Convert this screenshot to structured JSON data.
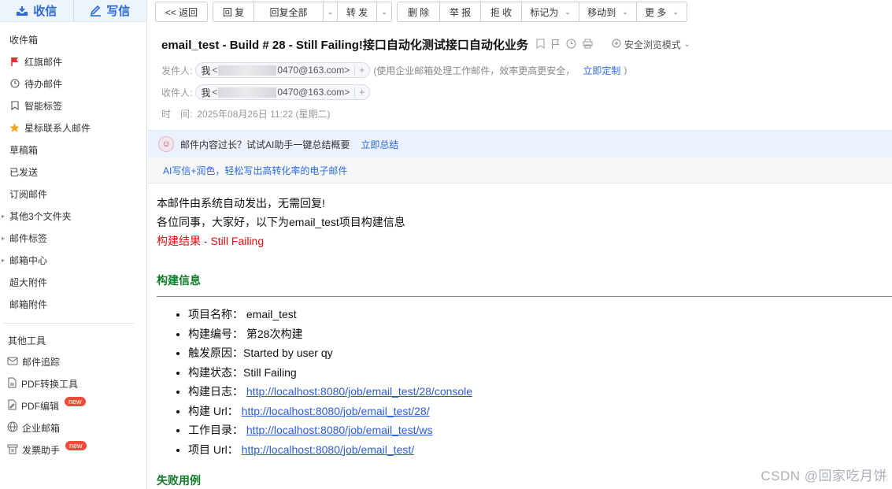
{
  "sidebar": {
    "receive_label": "收信",
    "write_label": "写信",
    "items": [
      {
        "label": "收件箱",
        "icon": ""
      },
      {
        "label": "红旗邮件",
        "icon": "flag-icon"
      },
      {
        "label": "待办邮件",
        "icon": "clock-icon"
      },
      {
        "label": "智能标签",
        "icon": "bookmark-icon"
      },
      {
        "label": "星标联系人邮件",
        "icon": "star-icon"
      },
      {
        "label": "草稿箱",
        "icon": ""
      },
      {
        "label": "已发送",
        "icon": ""
      },
      {
        "label": "订阅邮件",
        "icon": ""
      },
      {
        "label": "其他3个文件夹",
        "icon": "",
        "expandable": true
      },
      {
        "label": "邮件标签",
        "icon": "",
        "expandable": true
      },
      {
        "label": "邮箱中心",
        "icon": "",
        "expandable": true
      },
      {
        "label": "超大附件",
        "icon": ""
      },
      {
        "label": "邮箱附件",
        "icon": ""
      }
    ],
    "tools_title": "其他工具",
    "tools": [
      {
        "label": "邮件追踪",
        "icon": "envelope-track-icon",
        "badge": ""
      },
      {
        "label": "PDF转换工具",
        "icon": "pdf-convert-icon",
        "badge": ""
      },
      {
        "label": "PDF编辑",
        "icon": "pdf-edit-icon",
        "badge": "new"
      },
      {
        "label": "企业邮箱",
        "icon": "globe-icon",
        "badge": ""
      },
      {
        "label": "发票助手",
        "icon": "invoice-icon",
        "badge": "new"
      }
    ]
  },
  "toolbar": {
    "back": "<< 返回",
    "reply": "回 复",
    "reply_all": "回复全部",
    "forward": "转 发",
    "delete": "删 除",
    "report": "举 报",
    "reject": "拒 收",
    "mark_as": "标记为",
    "move_to": "移动到",
    "more": "更 多"
  },
  "mail": {
    "subject": "email_test - Build # 28 - Still Failing!接口自动化测试接口自动化业务",
    "safe_mode": "安全浏览模式",
    "from_label": "发件人:",
    "from_me": "我",
    "from_addr_prefix": "<",
    "from_addr_suffix": "0470@163.com>",
    "enterprise_hint": "(使用企业邮箱处理工作邮件，效率更高更安全，",
    "customize_link": "立即定制",
    "hint_close": ")",
    "to_label": "收件人:",
    "to_me": "我",
    "to_addr_prefix": "<",
    "to_addr_suffix": "0470@163.com>",
    "time_label": "时　间:",
    "time_value": "2025年08月26日 11:22 (星期二)",
    "ai_summary_text": "邮件内容过长？试试AI助手一键总结概要",
    "ai_summary_link": "立即总结",
    "ai_write": "AI写信+润色，轻松写出高转化率的电子邮件"
  },
  "body": {
    "line1": "本邮件由系统自动发出，无需回复!",
    "line2": "各位同事，大家好，以下为email_test项目构建信息",
    "result": "构建结果 - Still Failing",
    "section_build": "构建信息",
    "items": [
      {
        "label": "项目名称：",
        "value": "email_test",
        "link": false
      },
      {
        "label": "构建编号：",
        "value": "第28次构建",
        "link": false
      },
      {
        "label": "触发原因：",
        "value": "Started by user qy",
        "link": false
      },
      {
        "label": "构建状态：",
        "value": "Still Failing",
        "link": false
      },
      {
        "label": "构建日志：",
        "value": "http://localhost:8080/job/email_test/28/console",
        "link": true
      },
      {
        "label": "构建 Url：",
        "value": "http://localhost:8080/job/email_test/28/",
        "link": true
      },
      {
        "label": "工作目录：",
        "value": "http://localhost:8080/job/email_test/ws",
        "link": true
      },
      {
        "label": "项目 Url：",
        "value": "http://localhost:8080/job/email_test/",
        "link": true
      }
    ],
    "section_fail": "失败用例"
  },
  "watermark": "CSDN @回家吃月饼"
}
